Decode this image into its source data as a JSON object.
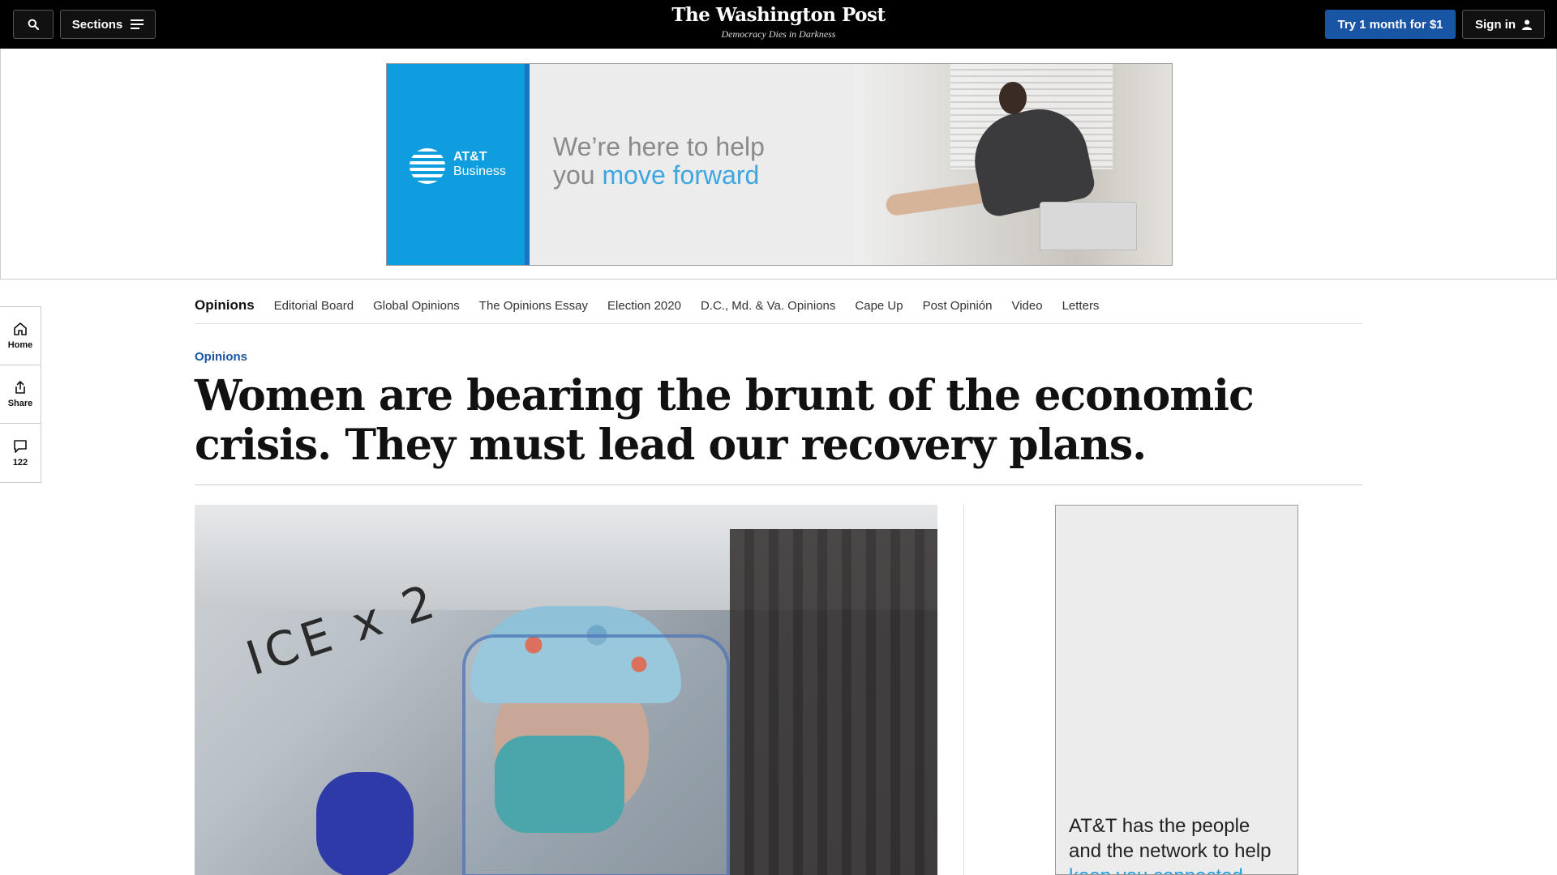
{
  "header": {
    "sections_label": "Sections",
    "logo": "The Washington Post",
    "tagline": "Democracy Dies in Darkness",
    "subscribe_label": "Try 1 month for $1",
    "signin_label": "Sign in"
  },
  "top_ad": {
    "brand_line1": "AT&T",
    "brand_line2": "Business",
    "headline_line1": "We’re here to help",
    "headline_line2_plain": "you ",
    "headline_line2_accent": "move forward"
  },
  "left_rail": {
    "home_label": "Home",
    "share_label": "Share",
    "comments_count": "122"
  },
  "section_nav": {
    "title": "Opinions",
    "links": [
      "Editorial Board",
      "Global Opinions",
      "The Opinions Essay",
      "Election 2020",
      "D.C., Md. & Va. Opinions",
      "Cape Up",
      "Post Opinión",
      "Video",
      "Letters"
    ]
  },
  "article": {
    "kicker": "Opinions",
    "headline": "Women are bearing the brunt of the economic crisis. They must lead our recovery plans.",
    "photo_scrawl": "ICE x 2"
  },
  "side_ad": {
    "line1": "AT&T has the people",
    "line2": "and the network to help",
    "accent": "keep you connected."
  },
  "colors": {
    "accent_blue": "#1955a5",
    "att_blue": "#0e9ee0"
  }
}
